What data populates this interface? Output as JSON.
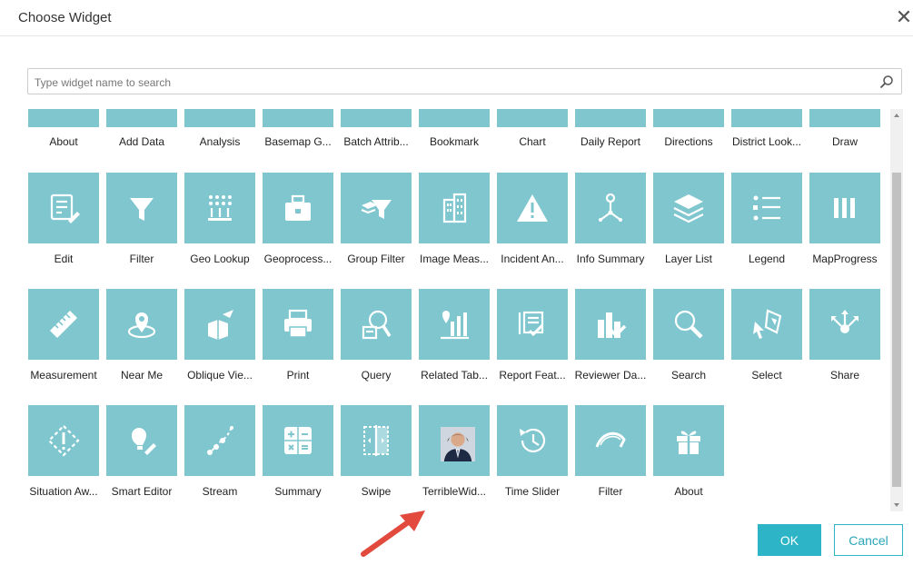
{
  "dialog": {
    "title": "Choose Widget"
  },
  "search": {
    "placeholder": "Type widget name to search"
  },
  "widgets": [
    "About",
    "Add Data",
    "Analysis",
    "Basemap G...",
    "Batch Attrib...",
    "Bookmark",
    "Chart",
    "Daily Report",
    "Directions",
    "District Look...",
    "Draw",
    "Edit",
    "Filter",
    "Geo Lookup",
    "Geoprocess...",
    "Group Filter",
    "Image Meas...",
    "Incident An...",
    "Info Summary",
    "Layer List",
    "Legend",
    "MapProgress",
    "Measurement",
    "Near Me",
    "Oblique Vie...",
    "Print",
    "Query",
    "Related Tab...",
    "Report Feat...",
    "Reviewer Da...",
    "Search",
    "Select",
    "Share",
    "Situation Aw...",
    "Smart Editor",
    "Stream",
    "Summary",
    "Swipe",
    "TerribleWid...",
    "Time Slider",
    "Filter",
    "About"
  ],
  "icons": [
    "tile-top",
    "tile-top",
    "tile-top",
    "tile-top",
    "tile-top",
    "tile-top",
    "tile-top",
    "tile-top",
    "tile-top",
    "tile-top",
    "tile-top",
    "edit-icon",
    "filter-icon",
    "geo-lookup-icon",
    "toolbox-icon",
    "group-filter-icon",
    "building-icon",
    "warning-icon",
    "info-summary-icon",
    "layers-icon",
    "legend-icon",
    "map-progress-icon",
    "ruler-icon",
    "near-me-icon",
    "oblique-view-icon",
    "print-icon",
    "query-icon",
    "related-table-icon",
    "report-feature-icon",
    "reviewer-dashboard-icon",
    "search-icon",
    "select-icon",
    "share-icon",
    "situation-awareness-icon",
    "smart-editor-icon",
    "stream-icon",
    "summary-icon",
    "swipe-icon",
    "person-photo",
    "time-slider-icon",
    "filter-arc-icon",
    "gift-icon"
  ],
  "buttons": {
    "ok": "OK",
    "cancel": "Cancel"
  },
  "colors": {
    "tile": "#7fc6cf",
    "primary": "#2db4c6",
    "arrow": "#e14a3d"
  }
}
